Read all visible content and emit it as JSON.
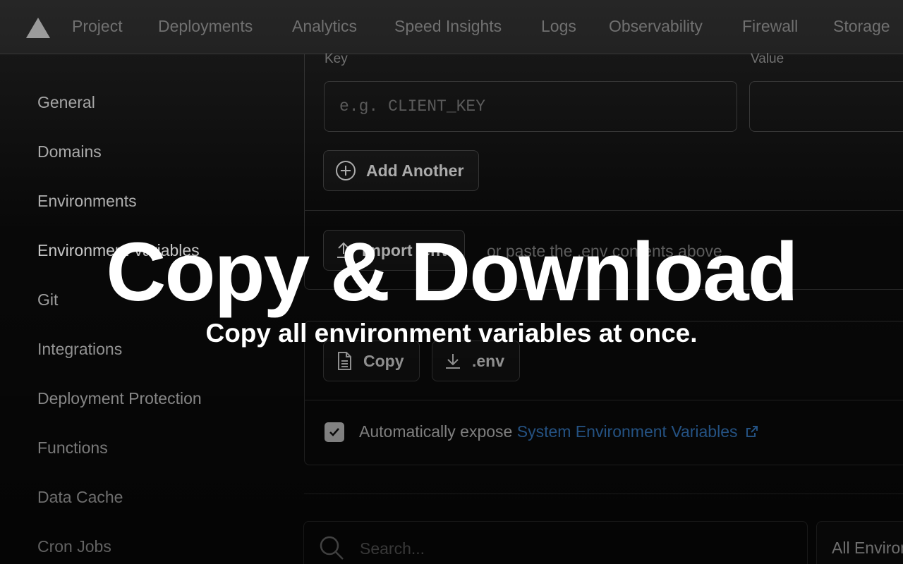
{
  "nav": {
    "items": [
      "Project",
      "Deployments",
      "Analytics",
      "Speed Insights",
      "Logs",
      "Observability",
      "Firewall",
      "Storage"
    ]
  },
  "sidebar": {
    "items": [
      "General",
      "Domains",
      "Environments",
      "Environment Variables",
      "Git",
      "Integrations",
      "Deployment Protection",
      "Functions",
      "Data Cache",
      "Cron Jobs"
    ]
  },
  "form": {
    "key_label": "Key",
    "value_label": "Value",
    "key_placeholder": "e.g. CLIENT_KEY",
    "add_another_label": "Add Another",
    "import_label": "Import .env",
    "paste_hint": "or paste the .env contents above"
  },
  "actions": {
    "copy_label": "Copy",
    "download_label": ".env"
  },
  "expose": {
    "checked": true,
    "text": "Automatically expose",
    "link": "System Environment Variables"
  },
  "search": {
    "placeholder": "Search..."
  },
  "env_filter": {
    "selected": "All Environments"
  },
  "overlay": {
    "headline": "Copy & Download",
    "subheadline": "Copy all environment variables at once."
  },
  "colors": {
    "link": "#3b86d6",
    "background": "#0a0a0a"
  },
  "icons": [
    "logo-triangle-icon",
    "plus-circle-icon",
    "upload-icon",
    "document-icon",
    "download-icon",
    "checkmark-icon",
    "external-link-icon",
    "search-icon"
  ]
}
